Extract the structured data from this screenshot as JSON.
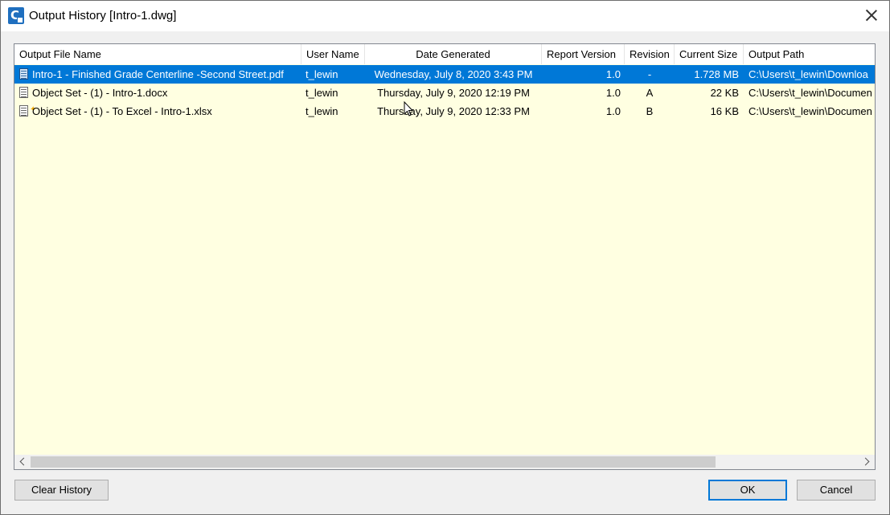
{
  "window": {
    "title": "Output History [Intro-1.dwg]"
  },
  "columns": [
    {
      "label": "Output File Name"
    },
    {
      "label": "User Name"
    },
    {
      "label": "Date Generated"
    },
    {
      "label": "Report Version"
    },
    {
      "label": "Revision"
    },
    {
      "label": "Current Size"
    },
    {
      "label": "Output Path"
    }
  ],
  "rows": [
    {
      "file_name": "Intro-1 - Finished Grade Centerline -Second Street.pdf",
      "user": "t_lewin",
      "date": "Wednesday, July 8, 2020 3:43 PM",
      "version": "1.0",
      "revision": "-",
      "size": "1.728 MB",
      "path": "C:\\Users\\t_lewin\\Downloa",
      "icon": "report-document-icon",
      "selected": true
    },
    {
      "file_name": "Object Set - (1) - Intro-1.docx",
      "user": "t_lewin",
      "date": "Thursday, July 9, 2020 12:19 PM",
      "version": "1.0",
      "revision": "A",
      "size": "22 KB",
      "path": "C:\\Users\\t_lewin\\Documen",
      "icon": "report-document-icon",
      "selected": false
    },
    {
      "file_name": "Object Set - (1) - To Excel - Intro-1.xlsx",
      "user": "t_lewin",
      "date": "Thursday, July 9, 2020 12:33 PM",
      "version": "1.0",
      "revision": "B",
      "size": "16 KB",
      "path": "C:\\Users\\t_lewin\\Documen",
      "icon": "new-report-document-icon",
      "selected": false
    }
  ],
  "buttons": {
    "clear_history": "Clear History",
    "ok": "OK",
    "cancel": "Cancel"
  },
  "colors": {
    "selection": "#0078d7",
    "list_background": "#ffffe1"
  }
}
